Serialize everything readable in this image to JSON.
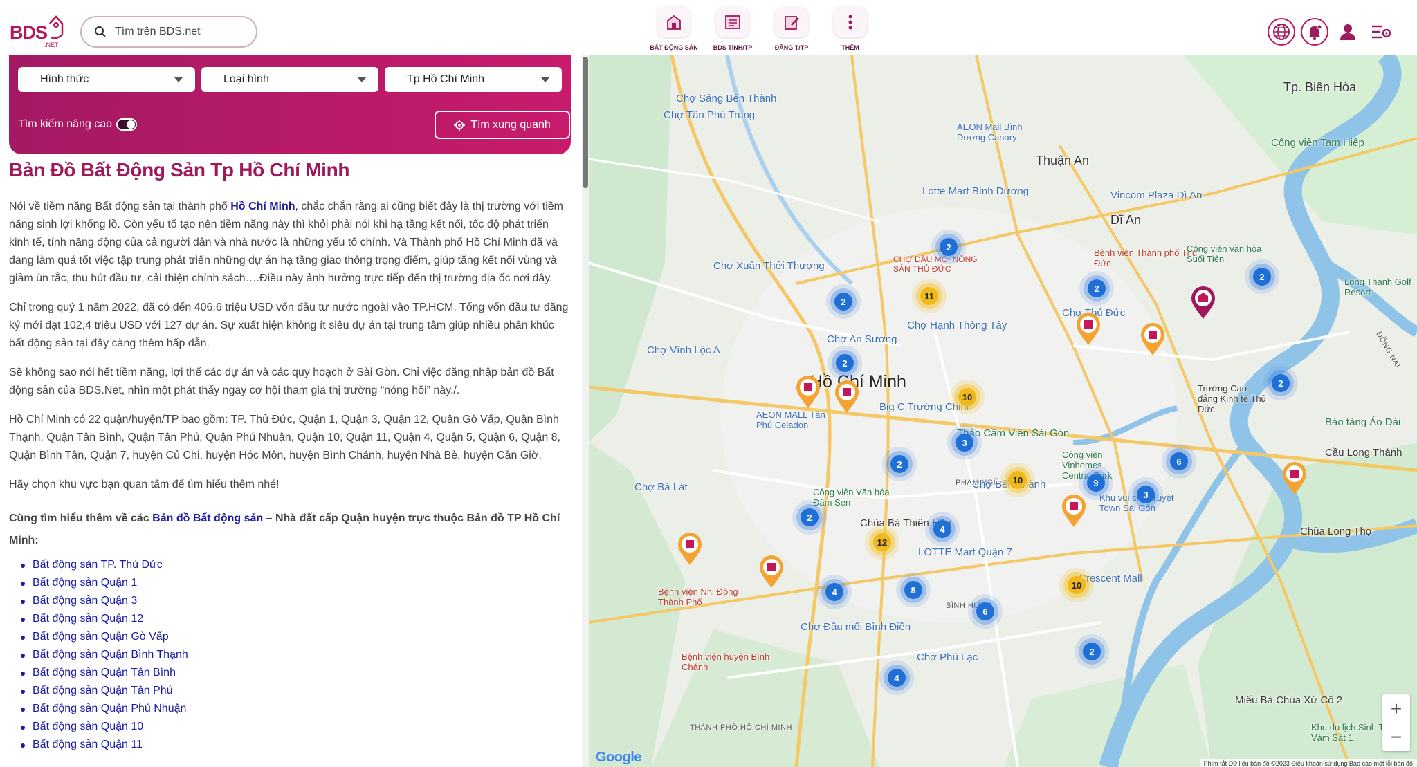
{
  "header": {
    "logo_text": "BDS",
    "logo_sub": ".NET",
    "search_placeholder": "Tìm trên BDS.net",
    "nav": [
      {
        "label": "BẤT ĐỘNG SẢN",
        "icon": "property-icon"
      },
      {
        "label": "BDS TỈNH/TP",
        "icon": "province-map-icon"
      },
      {
        "label": "ĐĂNG T/TP",
        "icon": "post-listing-icon"
      },
      {
        "label": "THÊM",
        "icon": "more-icon"
      }
    ]
  },
  "filters": {
    "hinh_thuc": "Hình thức",
    "loai_hinh": "Loại hình",
    "location": "Tp Hồ Chí Minh",
    "advanced_label": "Tìm kiếm nâng cao",
    "nearby_button": "Tìm xung quanh"
  },
  "article": {
    "title": "Bản Đồ Bất Động Sản Tp Hồ Chí Minh",
    "p1_a": "Nói về tiềm năng Bất động sản tại thành phố ",
    "p1_link": "Hồ Chí Minh",
    "p1_b": ", chắc chắn rằng ai cũng biết đây là thị trường với tiềm năng sinh lợi khổng lồ. Còn yếu tố tạo nên tiềm năng này thì khỏi phải nói khi hạ tầng kết nối, tốc độ phát triển kinh tế, tính năng động của cả người dân và nhà nước là những yếu tố chính. Và Thành phố Hồ Chí Minh đã và đang làm quá tốt việc tập trung phát triển những dự án hạ tầng giao thông trọng điểm, giúp tăng kết nối vùng và giảm ùn tắc, thu hút đầu tư, cải thiện chính sách….Điều này ảnh hưởng trực tiếp đến thị trường địa ốc nơi đây.",
    "p2": "Chỉ trong quý 1 năm 2022, đã có đến 406,6 triệu USD vốn đầu tư nước ngoài vào TP.HCM. Tổng vốn đầu tư đăng ký mới đạt 102,4 triệu USD với 127 dự án. Sự xuất hiện không ít siêu dự án tại trung tâm giúp nhiều phân khúc bất động sản tại đây càng thêm hấp dẫn.",
    "p3": "Sẽ không sao nói hết tiềm năng, lợi thế các dự án và các quy hoạch ở Sài Gòn. Chỉ việc đăng nhập bản đồ Bất động sản của BDS.Net, nhìn một phát thấy ngay cơ hội tham gia thị trường “nóng hổi” này./.",
    "p4": "Hồ Chí Minh có 22 quận/huyện/TP bao gồm: TP. Thủ Đức, Quận 1, Quận 3, Quận 12, Quận Gò Vấp, Quận Bình Thạnh, Quận Tân Bình, Quận Tân Phú, Quận Phú Nhuận, Quận 10, Quận 11, Quận 4, Quận 5, Quận 6, Quận 8, Quận Bình Tân, Quận 7, huyện Củ Chi, huyện Hóc Môn, huyện Bình Chánh, huyện Nhà Bè, huyện Cần Giờ.",
    "p5": "Hãy chọn khu vực bạn quan tâm để tìm hiểu thêm nhé!",
    "intro_a": "Cùng tìm hiểu thêm về các ",
    "intro_link": "Bản đồ Bất động sản",
    "intro_b": " – Nhà đất cấp Quận huyện trực thuộc Bản đồ TP Hồ Chí Minh:",
    "links": [
      "Bất động sản TP. Thủ Đức",
      "Bất động sản Quận 1",
      "Bất động sản Quận 3",
      "Bất động sản Quận 12",
      "Bất động sản Quận Gò Vấp",
      "Bất động sản Quận Bình Thạnh",
      "Bất động sản Quận Tân Bình",
      "Bất động sản Quận Tân Phú",
      "Bất động sản Quận Phú Nhuận",
      "Bất động sản Quận 10",
      "Bất động sản Quận 11"
    ]
  },
  "map": {
    "labels": {
      "city": "Hồ Chí Minh",
      "thuan_an": "Thuận An",
      "di_an": "Dĩ An",
      "bien_hoa": "Tp. Biên Hòa",
      "binh_hung": "BÌNH HƯNG",
      "pham_ngu_lao": "PHẠM NGŨ LÃO",
      "tphcm_bottom": "THÀNH PHỐ HỒ CHÍ MINH",
      "dong_nai": "ĐỒNG NAI",
      "aeon_binh_tan": "AEON MALL Tân Phú Celadon",
      "big_c": "Big C Trường Chinh",
      "thao_cam_vien": "Thảo Cầm Viên Sài Gòn",
      "lotte": "LOTTE Mart Quận 7",
      "crescent": "Crescent Mall",
      "vinhomes": "Công viên Vinhomes Central Park",
      "cho_ben_thanh": "Chợ Bến Thành",
      "cho_binh_dien": "Chợ Đầu mối Bình Điền",
      "bv_binh_chanh": "Bệnh viện huyện Bình Chánh",
      "bv_dong_thanh_pho": "Bệnh viện Nhi Đồng Thành Phố",
      "cho_ba_lat": "Chợ Bà Lát",
      "cho_phu_lac": "Chợ Phú Lạc",
      "mieu_ba_chua": "Miếu Bà Chúa Xứ Cố 2",
      "chua_long_tho": "Chùa Long Thọ",
      "cho_thu_duc": "Chợ Thủ Đức",
      "bv_thu_duc": "Bệnh viện Thành phố Thủ Đức",
      "cho_dau_moi": "CHỢ ĐẦU MỐI NÔNG SẢN THỦ ĐỨC",
      "aeon_canary": "AEON Mall Bình Dương Canary",
      "vincom_di_an": "Vincom Plaza Dĩ An",
      "lotte_binh_duong": "Lotte Mart Bình Dương",
      "cho_song_be": "Chợ Sáng Bến Thành",
      "cho_tan_phu_trung": "Chợ Tân Phú Trung",
      "cho_xuan_thoi": "Chợ Xuân Thới Thượng",
      "cho_vinh_loc": "Chợ Vĩnh Lộc A",
      "cho_an_suong": "Chợ An Sương",
      "cho_hanh_thong": "Chợ Hạnh Thông Tây",
      "truong_cao_dang": "Trường Cao đẳng Kinh tế Thủ Đức",
      "cong_vien_van_hoa": "Công viên Văn hóa Đầm Sen",
      "chua_ba_thien": "Chùa Bà Thiên Hậu",
      "bao_tang": "Bảo tàng Áo Dài",
      "cau_long_thanh": "Cầu Long Thành",
      "cong_vien_tam_hiep": "Công viên Tam Hiệp",
      "cong_vien_suoi_tien": "Công viên văn hóa Suối Tiên",
      "long_thanh_golf": "Long Thanh Golf Resort",
      "khu_vui_choi": "Khu vui chơi Tuyệt Town Sài Gòn",
      "khu_du_lich": "Khu du lịch Sinh Thái Vàm Sát 1"
    },
    "clusters_blue": [
      "2",
      "2",
      "2",
      "2",
      "2",
      "2",
      "3",
      "2",
      "6",
      "9",
      "3",
      "2",
      "4",
      "4",
      "8",
      "6",
      "4",
      "2"
    ],
    "clusters_yellow": [
      "11",
      "10",
      "10",
      "12",
      "10"
    ],
    "zoom_in": "+",
    "zoom_out": "−",
    "google": "Google",
    "attribution": "Phím tắt   Dữ liệu bản đồ ©2023   Điều khoản sử dụng   Báo cáo một lỗi bản đồ"
  }
}
